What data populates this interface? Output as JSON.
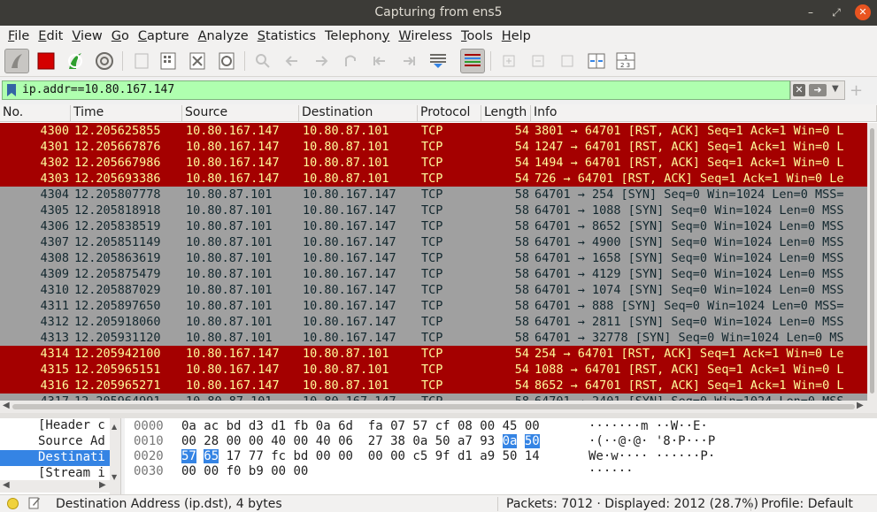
{
  "window": {
    "title": "Capturing from ens5"
  },
  "menu": [
    "File",
    "Edit",
    "View",
    "Go",
    "Capture",
    "Analyze",
    "Statistics",
    "Telephony",
    "Wireless",
    "Tools",
    "Help"
  ],
  "menu_underline": [
    "F",
    "E",
    "V",
    "G",
    "C",
    "A",
    "S",
    "y",
    "W",
    "T",
    "H"
  ],
  "toolbar": {
    "icons": [
      "shark-fin-start-icon",
      "stop-capture-icon",
      "restart-capture-icon",
      "capture-options-icon",
      "open-file-icon",
      "save-file-icon",
      "close-file-icon",
      "reload-file-icon",
      "find-packet-icon",
      "go-back-icon",
      "go-forward-icon",
      "go-to-packet-icon",
      "go-first-packet-icon",
      "go-last-packet-icon",
      "autoscroll-icon",
      "colorize-icon",
      "zoom-in-icon",
      "zoom-out-icon",
      "normal-size-icon",
      "resize-columns-icon",
      "layout-icon"
    ]
  },
  "filter": {
    "value": "ip.addr==10.80.167.147"
  },
  "packet_list": {
    "columns": [
      "No.",
      "Time",
      "Source",
      "Destination",
      "Protocol",
      "Length",
      "Info"
    ],
    "rows": [
      {
        "no": "4300",
        "time": "12.205625855",
        "src": "10.80.167.147",
        "dst": "10.80.87.101",
        "proto": "TCP",
        "len": "54",
        "info": "3801 → 64701 [RST, ACK] Seq=1 Ack=1 Win=0 L",
        "type": "rst"
      },
      {
        "no": "4301",
        "time": "12.205667876",
        "src": "10.80.167.147",
        "dst": "10.80.87.101",
        "proto": "TCP",
        "len": "54",
        "info": "1247 → 64701 [RST, ACK] Seq=1 Ack=1 Win=0 L",
        "type": "rst"
      },
      {
        "no": "4302",
        "time": "12.205667986",
        "src": "10.80.167.147",
        "dst": "10.80.87.101",
        "proto": "TCP",
        "len": "54",
        "info": "1494 → 64701 [RST, ACK] Seq=1 Ack=1 Win=0 L",
        "type": "rst"
      },
      {
        "no": "4303",
        "time": "12.205693386",
        "src": "10.80.167.147",
        "dst": "10.80.87.101",
        "proto": "TCP",
        "len": "54",
        "info": "726 → 64701 [RST, ACK] Seq=1 Ack=1 Win=0 Le",
        "type": "rst"
      },
      {
        "no": "4304",
        "time": "12.205807778",
        "src": "10.80.87.101",
        "dst": "10.80.167.147",
        "proto": "TCP",
        "len": "58",
        "info": "64701 → 254 [SYN] Seq=0 Win=1024 Len=0 MSS=",
        "type": "syn"
      },
      {
        "no": "4305",
        "time": "12.205818918",
        "src": "10.80.87.101",
        "dst": "10.80.167.147",
        "proto": "TCP",
        "len": "58",
        "info": "64701 → 1088 [SYN] Seq=0 Win=1024 Len=0 MSS",
        "type": "syn"
      },
      {
        "no": "4306",
        "time": "12.205838519",
        "src": "10.80.87.101",
        "dst": "10.80.167.147",
        "proto": "TCP",
        "len": "58",
        "info": "64701 → 8652 [SYN] Seq=0 Win=1024 Len=0 MSS",
        "type": "syn"
      },
      {
        "no": "4307",
        "time": "12.205851149",
        "src": "10.80.87.101",
        "dst": "10.80.167.147",
        "proto": "TCP",
        "len": "58",
        "info": "64701 → 4900 [SYN] Seq=0 Win=1024 Len=0 MSS",
        "type": "syn"
      },
      {
        "no": "4308",
        "time": "12.205863619",
        "src": "10.80.87.101",
        "dst": "10.80.167.147",
        "proto": "TCP",
        "len": "58",
        "info": "64701 → 1658 [SYN] Seq=0 Win=1024 Len=0 MSS",
        "type": "syn"
      },
      {
        "no": "4309",
        "time": "12.205875479",
        "src": "10.80.87.101",
        "dst": "10.80.167.147",
        "proto": "TCP",
        "len": "58",
        "info": "64701 → 4129 [SYN] Seq=0 Win=1024 Len=0 MSS",
        "type": "syn"
      },
      {
        "no": "4310",
        "time": "12.205887029",
        "src": "10.80.87.101",
        "dst": "10.80.167.147",
        "proto": "TCP",
        "len": "58",
        "info": "64701 → 1074 [SYN] Seq=0 Win=1024 Len=0 MSS",
        "type": "syn"
      },
      {
        "no": "4311",
        "time": "12.205897650",
        "src": "10.80.87.101",
        "dst": "10.80.167.147",
        "proto": "TCP",
        "len": "58",
        "info": "64701 → 888 [SYN] Seq=0 Win=1024 Len=0 MSS=",
        "type": "syn"
      },
      {
        "no": "4312",
        "time": "12.205918060",
        "src": "10.80.87.101",
        "dst": "10.80.167.147",
        "proto": "TCP",
        "len": "58",
        "info": "64701 → 2811 [SYN] Seq=0 Win=1024 Len=0 MSS",
        "type": "syn"
      },
      {
        "no": "4313",
        "time": "12.205931120",
        "src": "10.80.87.101",
        "dst": "10.80.167.147",
        "proto": "TCP",
        "len": "58",
        "info": "64701 → 32778 [SYN] Seq=0 Win=1024 Len=0 MS",
        "type": "syn"
      },
      {
        "no": "4314",
        "time": "12.205942100",
        "src": "10.80.167.147",
        "dst": "10.80.87.101",
        "proto": "TCP",
        "len": "54",
        "info": "254 → 64701 [RST, ACK] Seq=1 Ack=1 Win=0 Le",
        "type": "rst"
      },
      {
        "no": "4315",
        "time": "12.205965151",
        "src": "10.80.167.147",
        "dst": "10.80.87.101",
        "proto": "TCP",
        "len": "54",
        "info": "1088 → 64701 [RST, ACK] Seq=1 Ack=1 Win=0 L",
        "type": "rst"
      },
      {
        "no": "4316",
        "time": "12.205965271",
        "src": "10.80.167.147",
        "dst": "10.80.87.101",
        "proto": "TCP",
        "len": "54",
        "info": "8652 → 64701 [RST, ACK] Seq=1 Ack=1 Win=0 L",
        "type": "rst"
      },
      {
        "no": "4317",
        "time": "12.205964991",
        "src": "10.80.87.101",
        "dst": "10.80.167.147",
        "proto": "TCP",
        "len": "58",
        "info": "64701 → 2401 [SYN] Seq=0 Win=1024 Len=0 MSS",
        "type": "syn"
      }
    ]
  },
  "details": {
    "rows": [
      "[Header c",
      "Source Ad",
      "Destinati",
      "[Stream i"
    ],
    "selected_index": 2
  },
  "bytes": {
    "rows": [
      {
        "offset": "0000",
        "hex": [
          "0a",
          "ac",
          "bd",
          "d3",
          "d1",
          "fb",
          "0a",
          "6d",
          "fa",
          "07",
          "57",
          "cf",
          "08",
          "00",
          "45",
          "00"
        ],
        "ascii": "·······m ··W··E·"
      },
      {
        "offset": "0010",
        "hex": [
          "00",
          "28",
          "00",
          "00",
          "40",
          "00",
          "40",
          "06",
          "27",
          "38",
          "0a",
          "50",
          "a7",
          "93",
          "0a",
          "50"
        ],
        "ascii": "·(··@·@· '8·P···P"
      },
      {
        "offset": "0020",
        "hex": [
          "57",
          "65",
          "17",
          "77",
          "fc",
          "bd",
          "00",
          "00",
          "00",
          "00",
          "c5",
          "9f",
          "d1",
          "a9",
          "50",
          "14"
        ],
        "ascii": "We·w···· ······P·"
      },
      {
        "offset": "0030",
        "hex": [
          "00",
          "00",
          "f0",
          "b9",
          "00",
          "00"
        ],
        "ascii": "······"
      }
    ]
  },
  "status": {
    "field": "Destination Address (ip.dst), 4 bytes",
    "packets": "Packets: 7012 · Displayed: 2012 (28.7%)",
    "profile": "Profile: Default"
  },
  "colors": {
    "rst_bg": "#a40000",
    "rst_fg": "#fffc9c",
    "syn_bg": "#a0a0a0",
    "syn_fg": "#12272e",
    "filter_ok": "#afffaf",
    "selection": "#3584e4"
  }
}
